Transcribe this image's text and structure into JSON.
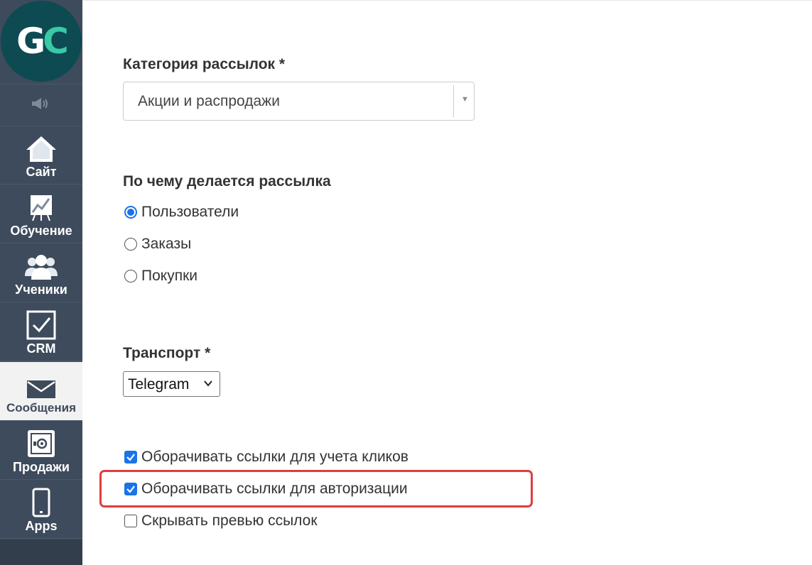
{
  "app": {
    "logo_letters": [
      "G",
      "C"
    ],
    "brand_colors": {
      "sidebar": "#3d4b5c",
      "logo_circle": "#0d4a52",
      "logo_accent": "#39c9a5",
      "highlight": "#e03c3c",
      "accent": "#1a73e8"
    }
  },
  "sidebar": {
    "top_icon": "speaker-icon",
    "items": [
      {
        "label": "Сайт",
        "icon": "home-icon",
        "active": false
      },
      {
        "label": "Обучение",
        "icon": "chart-board-icon",
        "active": false
      },
      {
        "label": "Ученики",
        "icon": "users-icon",
        "active": false
      },
      {
        "label": "CRM",
        "icon": "checkbox-icon",
        "active": false
      },
      {
        "label": "Сообщения",
        "icon": "envelope-icon",
        "active": true
      },
      {
        "label": "Продажи",
        "icon": "safe-icon",
        "active": false
      },
      {
        "label": "Apps",
        "icon": "phone-icon",
        "active": false
      }
    ]
  },
  "form": {
    "category": {
      "label": "Категория рассылок *",
      "value": "Акции и распродажи"
    },
    "basis": {
      "label": "По чему делается рассылка",
      "options": [
        {
          "label": "Пользователи",
          "selected": true
        },
        {
          "label": "Заказы",
          "selected": false
        },
        {
          "label": "Покупки",
          "selected": false
        }
      ]
    },
    "transport": {
      "label": "Транспорт *",
      "value": "Telegram"
    },
    "checkboxes": [
      {
        "label": "Оборачивать ссылки для учета кликов",
        "checked": true
      },
      {
        "label": "Оборачивать ссылки для авторизации",
        "checked": true,
        "highlighted": true
      },
      {
        "label": "Скрывать превью ссылок",
        "checked": false
      }
    ]
  }
}
